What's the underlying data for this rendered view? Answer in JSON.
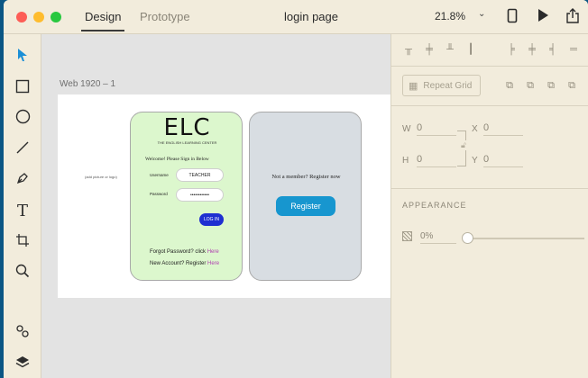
{
  "titlebar": {
    "tabs": [
      {
        "label": "Design",
        "active": true
      },
      {
        "label": "Prototype",
        "active": false
      }
    ],
    "document_title": "login page",
    "zoom": "21.8%",
    "icons": [
      "device-preview-icon",
      "play-icon",
      "share-icon"
    ]
  },
  "toolbar": {
    "tools": [
      "select-tool-icon",
      "rectangle-tool-icon",
      "ellipse-tool-icon",
      "line-tool-icon",
      "pen-tool-icon",
      "text-tool-icon",
      "artboard-tool-icon",
      "zoom-tool-icon"
    ],
    "bottom": [
      "assets-icon",
      "layers-icon"
    ]
  },
  "canvas": {
    "artboard_label": "Web 1920 – 1",
    "placeholder_text": "(add picture or logo)",
    "login_card": {
      "logo": "ELC",
      "subtitle": "THE ENGLISH LEARNING CENTER",
      "welcome": "Welcome! Please Sign in Below",
      "username_label": "Username",
      "username_value": "TEACHER",
      "password_label": "Password",
      "password_value": "••••••••••••",
      "login_button": "LOG IN",
      "forgot_text": "Forgot Password? click ",
      "forgot_link": "Here",
      "new_account_text": "New Account? Register ",
      "new_account_link": "Here"
    },
    "register_card": {
      "member_text": "Not a member? Register now",
      "register_button": "Register"
    }
  },
  "panel": {
    "repeat_grid": "Repeat Grid",
    "w_label": "W",
    "w_value": "0",
    "h_label": "H",
    "h_value": "0",
    "x_label": "X",
    "x_value": "0",
    "y_label": "Y",
    "y_value": "0",
    "appearance_title": "APPEARANCE",
    "opacity_value": "0%",
    "opacity_level": 0
  }
}
